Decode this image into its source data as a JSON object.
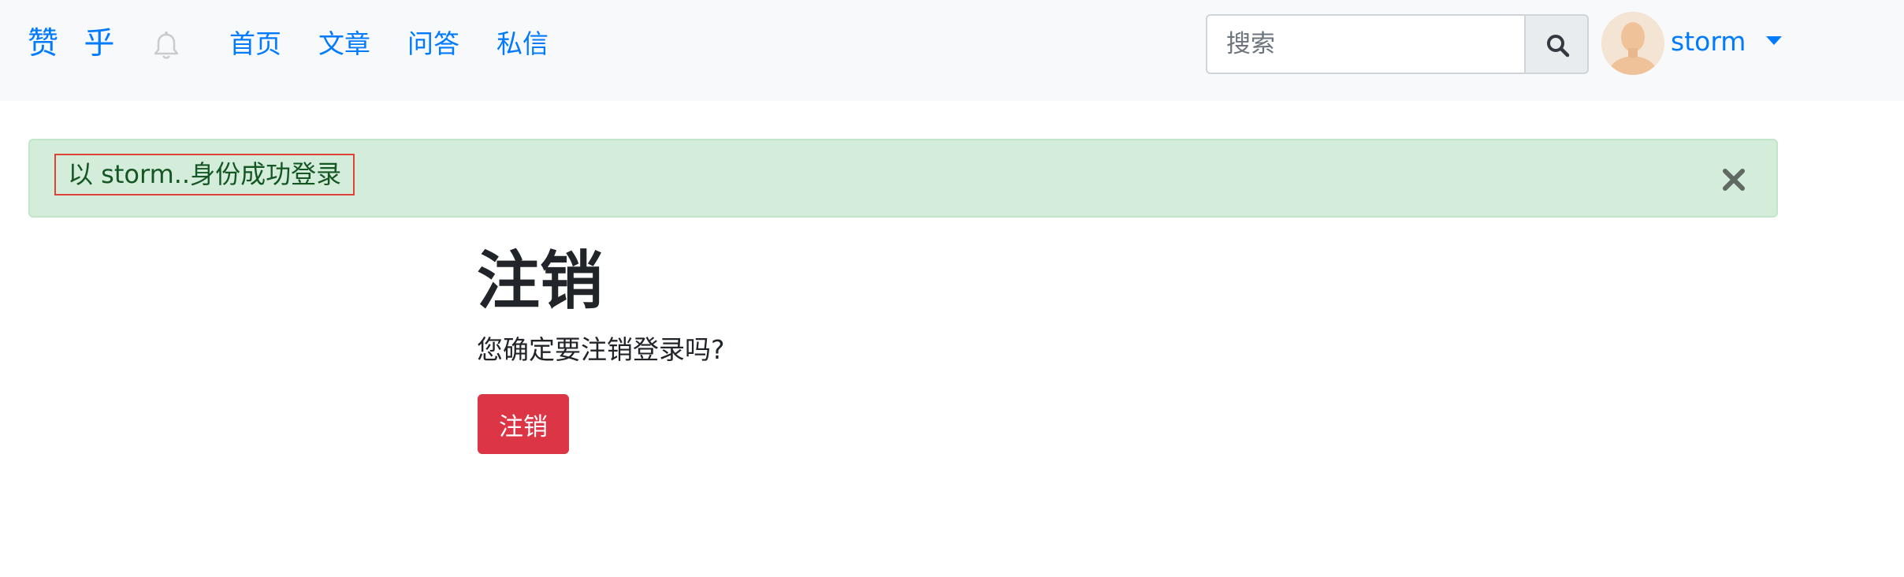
{
  "navbar": {
    "brand": "赞 乎",
    "links": [
      "首页",
      "文章",
      "问答",
      "私信"
    ],
    "search": {
      "placeholder": "搜索",
      "value": ""
    },
    "user": {
      "name": "storm"
    }
  },
  "alert": {
    "message": "以 storm..身份成功登录"
  },
  "main": {
    "title": "注销",
    "question": "您确定要注销登录吗?",
    "button_label": "注销"
  },
  "colors": {
    "link": "#007bff",
    "navbar_bg": "#f8f9fa",
    "alert_bg": "#d4edda",
    "alert_text": "#155724",
    "danger": "#dc3545"
  },
  "icons": [
    "bell-icon",
    "search-icon",
    "caret-down-icon",
    "close-icon"
  ]
}
